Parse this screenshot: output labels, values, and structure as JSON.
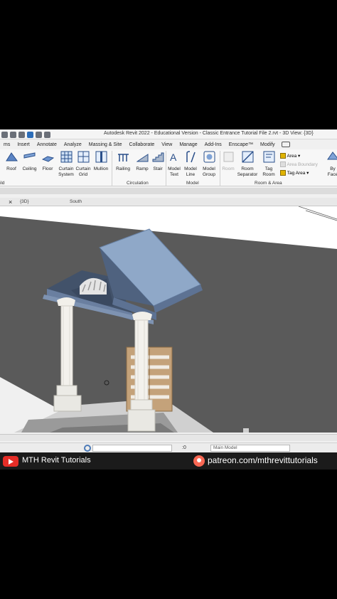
{
  "window": {
    "title": "Autodesk Revit 2022 - Educational Version - Classic Entrance Tutorial File 2.rvt - 3D View: {3D}"
  },
  "tabs": [
    "ms",
    "Insert",
    "Annotate",
    "Analyze",
    "Massing & Site",
    "Collaborate",
    "View",
    "Manage",
    "Add-Ins",
    "Enscape™",
    "Modify"
  ],
  "ribbon": {
    "roof": "Roof",
    "ceiling": "Ceiling",
    "floor": "Floor",
    "curtain_system": "Curtain System",
    "curtain_grid": "Curtain Grid",
    "mullion": "Mullion",
    "railing": "Railing",
    "ramp": "Ramp",
    "stair": "Stair",
    "model_text": "Model Text",
    "model_line": "Model Line",
    "model_group": "Model Group",
    "room": "Room",
    "room_separator": "Room Separator",
    "tag_room": "Tag Room",
    "area": "Area",
    "area_boundary": "Area Boundary",
    "tag_area": "Tag Area",
    "by_face": "By Face"
  },
  "groups": {
    "build": "ild",
    "circulation": "Circulation",
    "model": "Model",
    "room_area": "Room & Area"
  },
  "view_tabs": {
    "close": "×",
    "view": "{3D}",
    "south": "South"
  },
  "bottom": {
    "scale": ":0",
    "workset": "Main Model"
  },
  "banner": {
    "channel": "MTH Revit Tutorials",
    "patreon": "patreon.com/mthrevittutorials"
  },
  "colors": {
    "accent": "#2b6cb8",
    "roof": "#8fa8c8",
    "ground": "#5a5a5a",
    "youtube": "#e52d27",
    "patreon": "#f96854"
  }
}
